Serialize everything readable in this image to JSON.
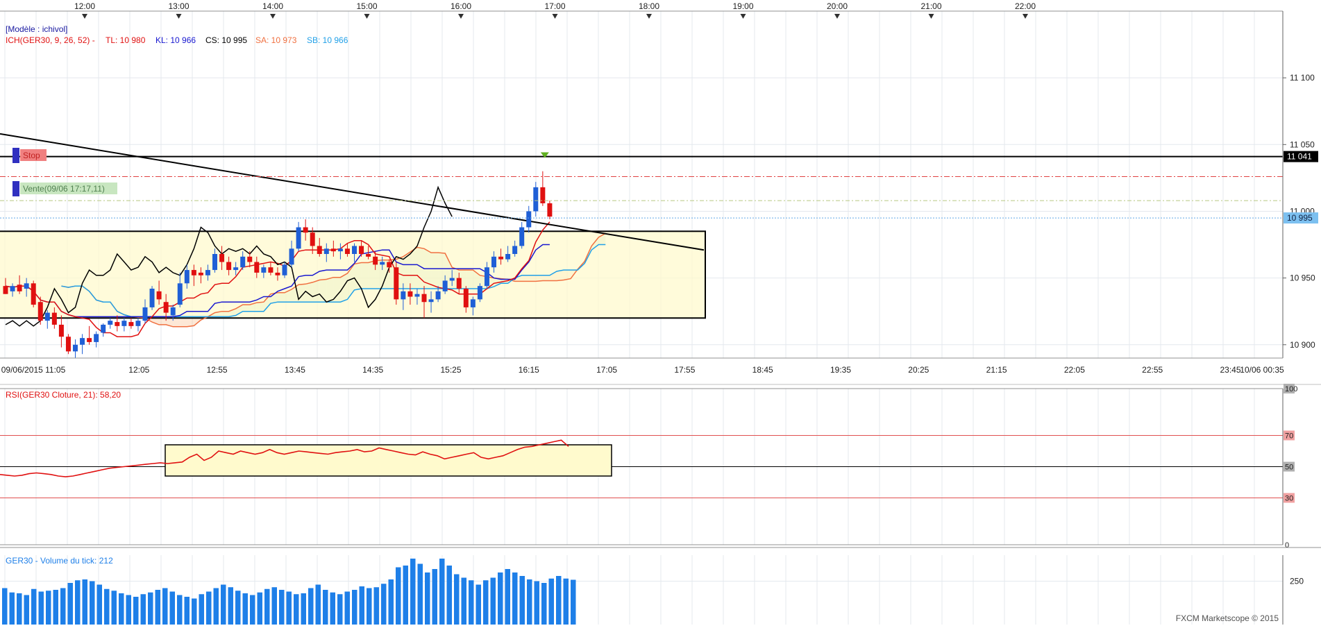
{
  "header": {
    "model": "[Modèle : ichivol]",
    "ich_label": "ICH(GER30, 9, 26, 52) -",
    "tl": "TL: 10 980",
    "kl": "KL: 10 966",
    "cs": "CS: 10 995",
    "sa": "SA: 10 973",
    "sb": "SB: 10 966"
  },
  "top_axis": [
    "12:00",
    "13:00",
    "14:00",
    "15:00",
    "16:00",
    "17:00",
    "18:00",
    "19:00",
    "20:00",
    "21:00",
    "22:00"
  ],
  "bottom_axis": [
    "09/06/2015 11:05",
    "12:05",
    "12:55",
    "13:45",
    "14:35",
    "15:25",
    "16:15",
    "17:05",
    "17:55",
    "18:45",
    "19:35",
    "20:25",
    "21:15",
    "22:05",
    "22:55",
    "23:45",
    "10/06 00:35"
  ],
  "price_axis": {
    "ticks": [
      "11 100",
      "11 050",
      "10 950",
      "10 900"
    ],
    "marker_stop": "11 041",
    "marker_cs": "10 995",
    "partial_label": "11 000"
  },
  "orders": {
    "stop": "Stop",
    "sell": "Vente(09/06 17:17,11)"
  },
  "rsi": {
    "label": "RSI(GER30 Cloture, 21): 58,20",
    "levels": [
      "100",
      "70",
      "50",
      "30",
      "0"
    ]
  },
  "volume": {
    "label": "GER30 - Volume du tick: 212",
    "tick": "250"
  },
  "footer": "FXCM Marketscope © 2015",
  "colors": {
    "up_candle": "#1f5fd6",
    "down_candle": "#e01010",
    "tenkan": "#e01010",
    "kijun": "#1818d0",
    "senkou_a": "#f07040",
    "senkou_b": "#20a0e8",
    "chikou": "#000000",
    "zone_fill": "#fffacd",
    "volume": "#1e7fe8"
  },
  "chart_data": {
    "type": "candlestick",
    "instrument": "GER30",
    "candles": [
      [
        10944,
        10950,
        10938,
        10938
      ],
      [
        10940,
        10946,
        10936,
        10944
      ],
      [
        10945,
        10952,
        10938,
        10940
      ],
      [
        10942,
        10950,
        10936,
        10946
      ],
      [
        10946,
        10948,
        10928,
        10930
      ],
      [
        10932,
        10936,
        10915,
        10918
      ],
      [
        10918,
        10926,
        10912,
        10924
      ],
      [
        10924,
        10928,
        10912,
        10915
      ],
      [
        10915,
        10922,
        10898,
        10906
      ],
      [
        10906,
        10908,
        10893,
        10895
      ],
      [
        10895,
        10904,
        10890,
        10900
      ],
      [
        10900,
        10908,
        10893,
        10905
      ],
      [
        10905,
        10914,
        10900,
        10902
      ],
      [
        10902,
        10910,
        10898,
        10908
      ],
      [
        10909,
        10916,
        10906,
        10915
      ],
      [
        10915,
        10920,
        10912,
        10918
      ],
      [
        10917,
        10922,
        10910,
        10914
      ],
      [
        10914,
        10920,
        10910,
        10918
      ],
      [
        10917,
        10920,
        10912,
        10914
      ],
      [
        10914,
        10920,
        10910,
        10918
      ],
      [
        10918,
        10934,
        10916,
        10928
      ],
      [
        10928,
        10944,
        10926,
        10942
      ],
      [
        10940,
        10948,
        10930,
        10934
      ],
      [
        10932,
        10938,
        10918,
        10924
      ],
      [
        10922,
        10930,
        10918,
        10928
      ],
      [
        10930,
        10954,
        10928,
        10946
      ],
      [
        10946,
        10960,
        10942,
        10956
      ],
      [
        10956,
        10960,
        10944,
        10952
      ],
      [
        10954,
        10958,
        10946,
        10952
      ],
      [
        10952,
        10960,
        10948,
        10956
      ],
      [
        10956,
        10972,
        10954,
        10968
      ],
      [
        10968,
        10974,
        10956,
        10962
      ],
      [
        10962,
        10966,
        10952,
        10956
      ],
      [
        10956,
        10962,
        10952,
        10958
      ],
      [
        10958,
        10970,
        10956,
        10966
      ],
      [
        10966,
        10970,
        10958,
        10962
      ],
      [
        10962,
        10966,
        10950,
        10954
      ],
      [
        10954,
        10960,
        10950,
        10958
      ],
      [
        10958,
        10962,
        10952,
        10954
      ],
      [
        10954,
        10958,
        10948,
        10952
      ],
      [
        10952,
        10962,
        10950,
        10960
      ],
      [
        10960,
        10978,
        10958,
        10972
      ],
      [
        10972,
        10992,
        10970,
        10988
      ],
      [
        10988,
        10994,
        10978,
        10984
      ],
      [
        10984,
        10988,
        10968,
        10974
      ],
      [
        10974,
        10980,
        10966,
        10968
      ],
      [
        10968,
        10976,
        10962,
        10972
      ],
      [
        10972,
        10978,
        10966,
        10970
      ],
      [
        10970,
        10976,
        10964,
        10972
      ],
      [
        10972,
        10976,
        10966,
        10968
      ],
      [
        10968,
        10976,
        10962,
        10974
      ],
      [
        10974,
        10978,
        10966,
        10968
      ],
      [
        10968,
        10974,
        10964,
        10966
      ],
      [
        10966,
        10970,
        10956,
        10960
      ],
      [
        10960,
        10966,
        10956,
        10962
      ],
      [
        10962,
        10964,
        10954,
        10958
      ],
      [
        10958,
        10962,
        10930,
        10934
      ],
      [
        10934,
        10946,
        10926,
        10940
      ],
      [
        10940,
        10946,
        10930,
        10936
      ],
      [
        10936,
        10942,
        10930,
        10938
      ],
      [
        10938,
        10944,
        10920,
        10932
      ],
      [
        10932,
        10940,
        10924,
        10934
      ],
      [
        10934,
        10944,
        10932,
        10940
      ],
      [
        10940,
        10952,
        10938,
        10948
      ],
      [
        10948,
        10956,
        10944,
        10950
      ],
      [
        10950,
        10954,
        10938,
        10942
      ],
      [
        10942,
        10944,
        10924,
        10928
      ],
      [
        10928,
        10936,
        10922,
        10934
      ],
      [
        10934,
        10946,
        10932,
        10944
      ],
      [
        10944,
        10962,
        10942,
        10958
      ],
      [
        10958,
        10970,
        10954,
        10966
      ],
      [
        10966,
        10972,
        10960,
        10964
      ],
      [
        10964,
        10974,
        10962,
        10968
      ],
      [
        10968,
        10978,
        10966,
        10974
      ],
      [
        10974,
        10992,
        10972,
        10988
      ],
      [
        10988,
        11004,
        10984,
        11000
      ],
      [
        11000,
        11022,
        10996,
        11018
      ],
      [
        11018,
        11030,
        11004,
        11006
      ],
      [
        11006,
        11008,
        10994,
        10996
      ]
    ],
    "volume": [
      210,
      185,
      180,
      170,
      205,
      190,
      195,
      200,
      210,
      240,
      255,
      260,
      250,
      230,
      205,
      195,
      180,
      170,
      160,
      175,
      185,
      200,
      210,
      190,
      170,
      160,
      150,
      175,
      190,
      210,
      230,
      215,
      195,
      180,
      170,
      185,
      205,
      215,
      200,
      190,
      175,
      180,
      210,
      230,
      200,
      185,
      175,
      190,
      200,
      220,
      210,
      215,
      235,
      260,
      330,
      340,
      380,
      350,
      300,
      320,
      380,
      340,
      290,
      270,
      255,
      230,
      255,
      270,
      300,
      320,
      300,
      280,
      260,
      250,
      240,
      265,
      280,
      265,
      258
    ],
    "rsi": [
      45.0,
      44.5,
      44.0,
      44.5,
      45.5,
      46.0,
      45.5,
      45.0,
      44.0,
      43.5,
      44.0,
      45.0,
      46.0,
      47.0,
      48.0,
      49.0,
      49.5,
      50.0,
      50.5,
      51.0,
      51.5,
      52.0,
      52.5,
      52.0,
      52.5,
      53.0,
      56.0,
      58.0,
      54.0,
      56.0,
      60.0,
      59.0,
      58.0,
      60.0,
      59.0,
      58.0,
      59.0,
      61.0,
      59.0,
      58.0,
      59.0,
      60.0,
      59.5,
      59.0,
      58.5,
      58.0,
      59.0,
      59.5,
      60.0,
      61.0,
      59.5,
      60.0,
      62.0,
      61.0,
      60.0,
      59.0,
      58.0,
      57.5,
      59.5,
      58.0,
      57.0,
      55.0,
      56.0,
      57.0,
      58.0,
      59.0,
      56.0,
      55.0,
      56.0,
      57.0,
      59.0,
      61.0,
      62.5,
      63.0,
      64.0,
      65.0,
      66.0,
      67.0,
      63.0
    ],
    "indicators": {
      "stop_level": 11041,
      "sell_level": 11008,
      "cs_level": 10995,
      "tl": 10980,
      "kl": 10966,
      "cs": 10995,
      "sa": 10973,
      "sb": 10966
    },
    "rsi_levels": [
      100,
      70,
      50,
      30,
      0
    ]
  }
}
